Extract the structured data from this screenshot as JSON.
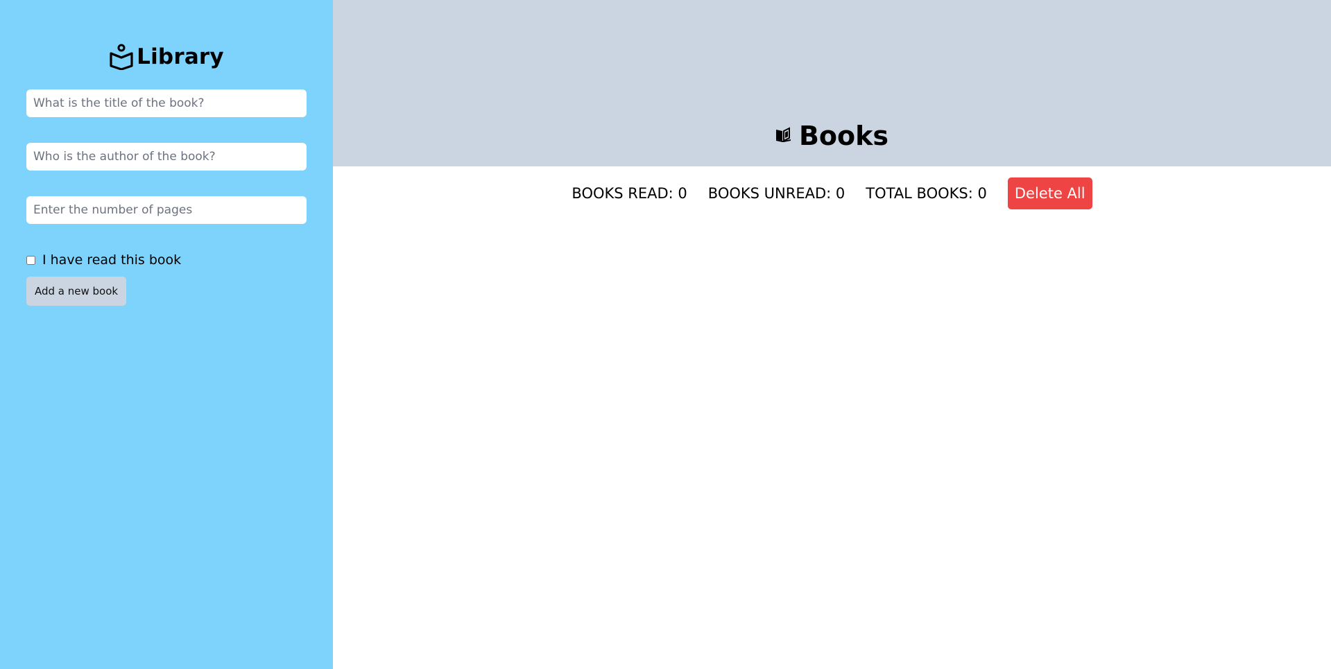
{
  "sidebar": {
    "brand": {
      "title": "Library",
      "icon": "book-reader-icon"
    },
    "form": {
      "title_placeholder": "What is the title of the book?",
      "title_value": "",
      "author_placeholder": "Who is the author of the book?",
      "author_value": "",
      "pages_placeholder": "Enter the number of pages",
      "pages_value": "",
      "read_label": "I have read this book",
      "read_checked": false,
      "submit_label": "Add a new book"
    }
  },
  "header": {
    "title": "Books",
    "icon": "open-book-icon"
  },
  "stats": {
    "read": "BOOKS READ: 0",
    "unread": "BOOKS UNREAD: 0",
    "total": "TOTAL BOOKS: 0",
    "delete_label": "Delete All"
  },
  "colors": {
    "sidebar_bg": "#7dd3fc",
    "header_bg": "#cbd5e1",
    "add_button_bg": "#cbd5e1",
    "delete_button_bg": "#ef4444"
  }
}
